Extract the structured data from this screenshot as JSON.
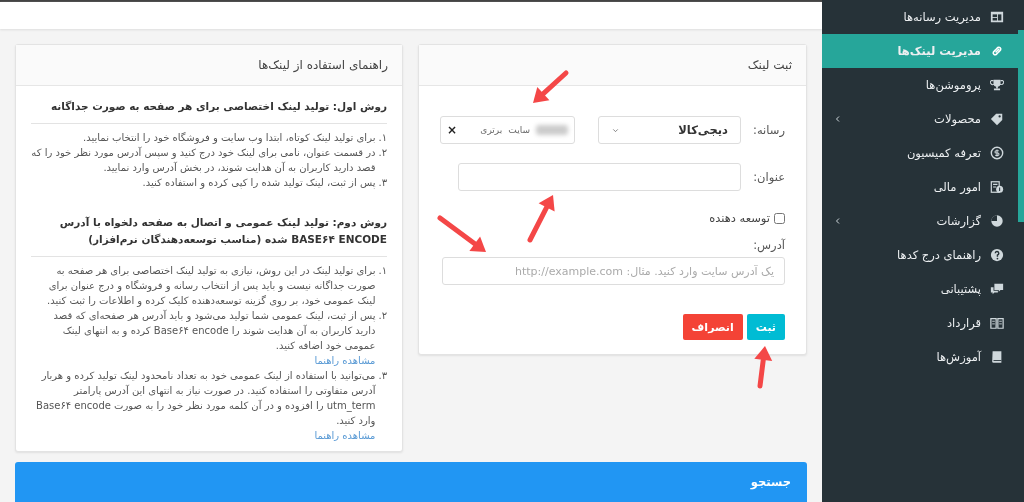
{
  "sidebar": {
    "items": [
      {
        "label": "مدیریت رسانه‌ها",
        "selected": false,
        "has_children": false
      },
      {
        "label": "مدیریت لینک‌ها",
        "selected": true,
        "has_children": false
      },
      {
        "label": "پروموشن‌ها",
        "selected": false,
        "has_children": false
      },
      {
        "label": "محصولات",
        "selected": false,
        "has_children": true
      },
      {
        "label": "تعرفه کمیسیون",
        "selected": false,
        "has_children": false
      },
      {
        "label": "امور مالی",
        "selected": false,
        "has_children": false
      },
      {
        "label": "گزارشات",
        "selected": false,
        "has_children": true
      },
      {
        "label": "راهنمای درج کدها",
        "selected": false,
        "has_children": false
      },
      {
        "label": "پشتیبانی",
        "selected": false,
        "has_children": false
      },
      {
        "label": "قرارداد",
        "selected": false,
        "has_children": false
      },
      {
        "label": "آموزش‌ها",
        "selected": false,
        "has_children": false
      }
    ]
  },
  "form_panel": {
    "title": "ثبت لینک",
    "media_label": "رسانه:",
    "media_select": {
      "value": "دیجی‌کالا"
    },
    "site_tag": {
      "parts": [
        "سایت",
        "برتری"
      ],
      "remove": "×"
    },
    "title_label": "عنوان:",
    "developer_checkbox": {
      "label": "توسعه دهنده",
      "checked": false
    },
    "address_label": "آدرس:",
    "address_field": {
      "placeholder": "یک آدرس سایت وارد کنید. مثال: http://example.com"
    },
    "buttons": [
      {
        "label": "ثبت",
        "kind": "primary"
      },
      {
        "label": "انصراف",
        "kind": "danger"
      }
    ]
  },
  "guide_panel": {
    "title": "راهنمای استفاده از لینک‌ها",
    "sections": [
      {
        "heading": "روش اول: تولید لینک اختصاصی برای هر صفحه به صورت جداگانه",
        "items": [
          {
            "number": "۱.",
            "text": "برای تولید لینک کوتاه، ابتدا وب سایت و فروشگاه خود را انتخاب نمایید."
          },
          {
            "number": "۲.",
            "text": "در قسمت عنوان، نامی برای لینک خود درج کنید و سپس آدرس مورد نظر خود را که قصد دارید کاربران به آن هدایت شوند، در بخش آدرس وارد نمایید."
          },
          {
            "number": "۳.",
            "text": "پس از ثبت، لینک تولید شده را کپی کرده و استفاده کنید."
          }
        ]
      },
      {
        "heading": "روش دوم: تولید لینک عمومی و اتصال به صفحه دلخواه با آدرس BASE۶۴ ENCODE شده (مناسب توسعه‌دهندگان نرم‌افزار)",
        "items": [
          {
            "number": "۱.",
            "text": "برای تولید لینک در این روش، نیازی به تولید لینک اختصاصی برای هر صفحه به صورت جداگانه نیست و باید پس از انتخاب رسانه و فروشگاه و درج عنوان برای لینک عمومی خود، بر روی گزینه توسعه‌دهنده کلیک کرده و اطلاعات را ثبت کنید."
          },
          {
            "number": "۲.",
            "text": "پس از ثبت، لینک عمومی شما تولید می‌شود و باید آدرس هر صفحه‌ای که قصد دارید کاربران به آن هدایت شوند را Base۶۴ encode کرده و به انتهای لینک عمومی خود اضافه کنید.",
            "link": "مشاهده راهنما"
          },
          {
            "number": "۳.",
            "text": "می‌توانید با استفاده از لینک عمومی خود به تعداد نامحدود لینک تولید کرده و هربار آدرس متفاوتی را استفاده کنید. در صورت نیاز به انتهای این آدرس پارامتر utm_term را افزوده و در آن کلمه مورد نظر خود را به صورت Base۶۴ encode وارد کنید.",
            "link": "مشاهده راهنما"
          }
        ]
      }
    ]
  },
  "search_bar": {
    "title": "جستجو"
  }
}
